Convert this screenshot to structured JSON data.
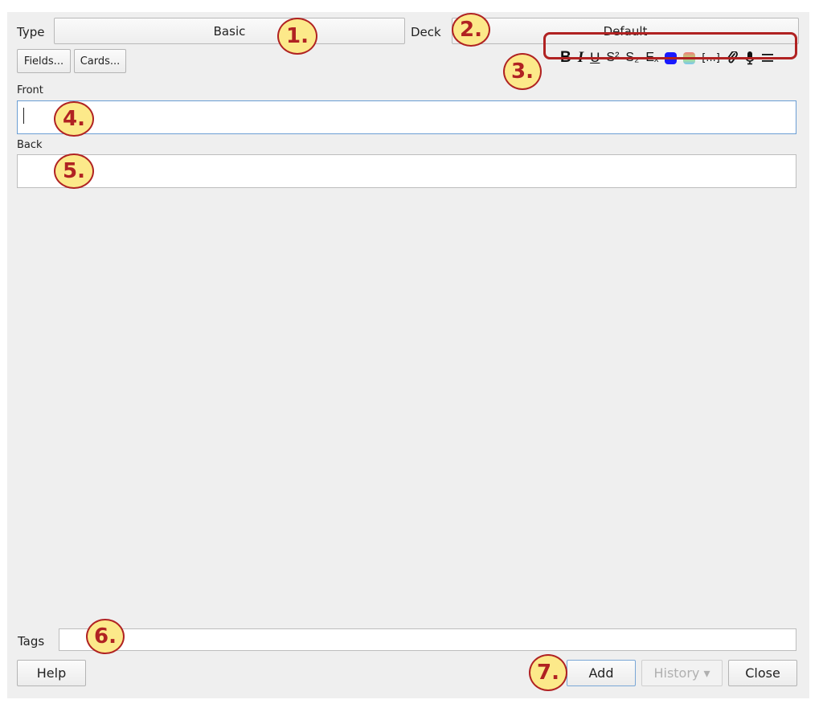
{
  "header": {
    "type_label": "Type",
    "type_value": "Basic",
    "deck_label": "Deck",
    "deck_value": "Default"
  },
  "buttons": {
    "fields": "Fields...",
    "cards": "Cards...",
    "help": "Help",
    "add": "Add",
    "history": "History ▾",
    "close": "Close"
  },
  "toolbar": {
    "bold": "B",
    "italic": "I",
    "underline": "U",
    "superscript": "S²",
    "subscript": "S₂",
    "clear_format": "Eₓ",
    "cloze": "[...]",
    "text_color": "#1a1aff",
    "highlight_colors": [
      "#f27979",
      "#b6e37a",
      "#7ac7f2"
    ],
    "icons": [
      "paperclip-icon",
      "microphone-icon",
      "menu-icon"
    ]
  },
  "fields": [
    {
      "label": "Front",
      "value": ""
    },
    {
      "label": "Back",
      "value": ""
    }
  ],
  "tags": {
    "label": "Tags",
    "value": ""
  },
  "annotations": [
    "1.",
    "2.",
    "3.",
    "4.",
    "5.",
    "6.",
    "7."
  ],
  "colors": {
    "annotation_red": "#b02222",
    "annotation_fill": "#fce98a",
    "focus": "#6b9ed4"
  }
}
